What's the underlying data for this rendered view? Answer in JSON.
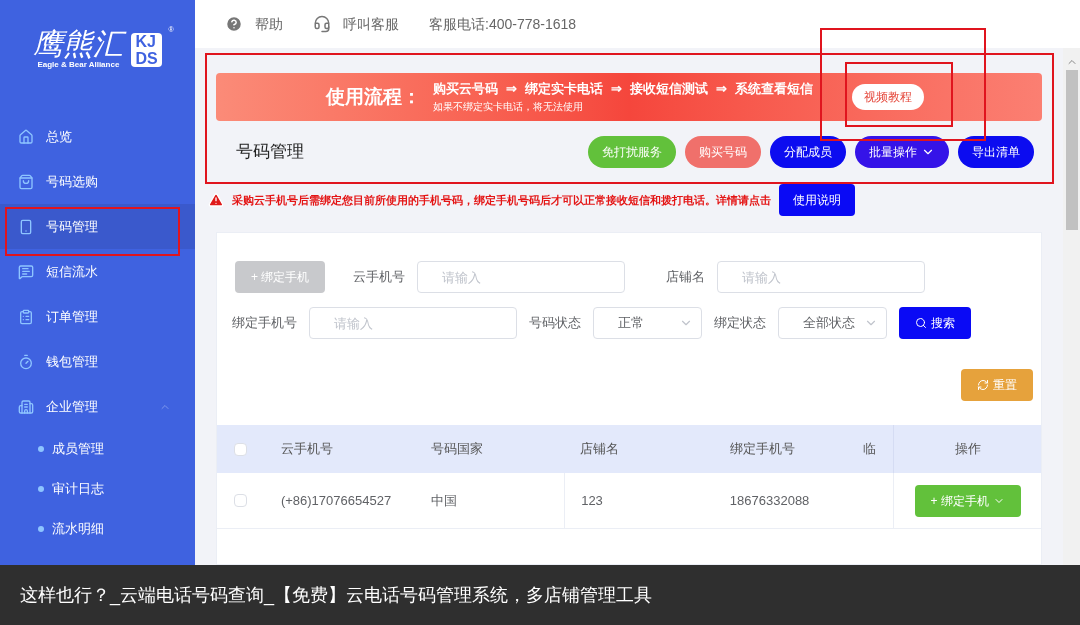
{
  "logo": {
    "script": "鹰熊汇",
    "tagline": "Eagle & Bear Alliance",
    "badge_top": "KJ",
    "badge_bottom": "DS",
    "mark": "®"
  },
  "header": {
    "help": "帮助",
    "call_service": "呼叫客服",
    "phone": "客服电话:400-778-1618"
  },
  "sidebar": {
    "items": [
      {
        "label": "总览",
        "selected": false
      },
      {
        "label": "号码选购",
        "selected": false
      },
      {
        "label": "号码管理",
        "selected": true
      },
      {
        "label": "短信流水",
        "selected": false
      },
      {
        "label": "订单管理",
        "selected": false
      },
      {
        "label": "钱包管理",
        "selected": false
      },
      {
        "label": "企业管理",
        "selected": false,
        "expanded": true,
        "children": [
          {
            "label": "成员管理",
            "selected": false
          },
          {
            "label": "审计日志",
            "selected": false
          },
          {
            "label": "流水明细",
            "selected": false
          }
        ]
      }
    ]
  },
  "banner": {
    "title": "使用流程：",
    "steps": [
      "购买云号码",
      "绑定实卡电话",
      "接收短信测试",
      "系统查看短信"
    ],
    "arrow": "⇒",
    "note": "如果不绑定实卡电话，将无法使用",
    "button": "视频教程"
  },
  "page_title": "号码管理",
  "actions": [
    {
      "label": "免打扰服务",
      "color": "#62c13b",
      "dropdown": false
    },
    {
      "label": "购买号码",
      "color": "#f0706b",
      "dropdown": false
    },
    {
      "label": "分配成员",
      "color": "#0c0cf0",
      "dropdown": false
    },
    {
      "label": "批量操作",
      "color": "#3513e8",
      "dropdown": true
    },
    {
      "label": "导出清单",
      "color": "#0c0cf0",
      "dropdown": false
    }
  ],
  "notice": {
    "text": "采购云手机号后需绑定您目前所使用的手机号码，绑定手机号码后才可以正常接收短信和拨打电话。详情请点击",
    "button": "使用说明"
  },
  "filters": {
    "bind_button": {
      "label": "+ 绑定手机",
      "disabled": true
    },
    "cloud_number": {
      "label": "云手机号",
      "placeholder": "请输入"
    },
    "shop_name": {
      "label": "店铺名",
      "placeholder": "请输入"
    },
    "bound_number": {
      "label": "绑定手机号",
      "placeholder": "请输入"
    },
    "number_status": {
      "label": "号码状态",
      "value": "正常"
    },
    "bind_status": {
      "label": "绑定状态",
      "value": "全部状态"
    },
    "search": "搜索",
    "reset": "重置"
  },
  "table": {
    "all_checked": false,
    "columns": [
      "云手机号",
      "号码国家",
      "店铺名",
      "绑定手机号",
      "临",
      "操作"
    ],
    "rows": [
      {
        "checked": false,
        "cells": [
          "(+86)17076654527",
          "中国",
          "123",
          "18676332088"
        ],
        "action": "+ 绑定手机"
      }
    ]
  },
  "caption": "这样也行？_云端电话号码查询_【免费】云电话号码管理系统，多店铺管理工具"
}
